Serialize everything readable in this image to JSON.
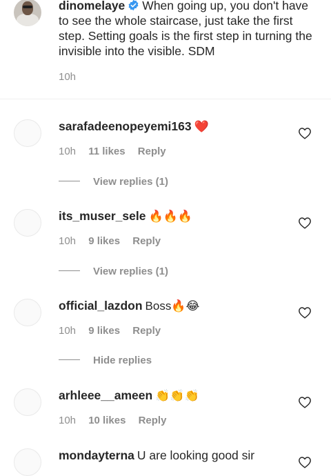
{
  "caption": {
    "username": "dinomelaye",
    "text": "When going up, you don't have to see the whole staircase, just take the first step. Setting goals is the first step in turning the invisible into the visible. SDM",
    "time": "10h"
  },
  "comments": [
    {
      "username": "sarafadeenopeyemi163",
      "text": "❤️",
      "time": "10h",
      "likes": "11 likes",
      "reply_label": "Reply",
      "replies_label": "View replies (1)"
    },
    {
      "username": "its_muser_sele",
      "text": "🔥🔥🔥",
      "time": "10h",
      "likes": "9 likes",
      "reply_label": "Reply",
      "replies_label": "View replies (1)"
    },
    {
      "username": "official_lazdon",
      "text": "Boss🔥😂",
      "time": "10h",
      "likes": "9 likes",
      "reply_label": "Reply",
      "replies_label": "Hide replies"
    },
    {
      "username": "arhleee__ameen",
      "text": "👏👏👏",
      "time": "10h",
      "likes": "10 likes",
      "reply_label": "Reply"
    },
    {
      "username": "mondayterna",
      "text": "U are looking good sir"
    }
  ],
  "icons": {
    "verified": "verified-badge-icon",
    "like": "heart-outline-icon"
  },
  "colors": {
    "verified_blue": "#3897f0",
    "secondary_text": "#8e8e8e",
    "primary_text": "#262626"
  }
}
